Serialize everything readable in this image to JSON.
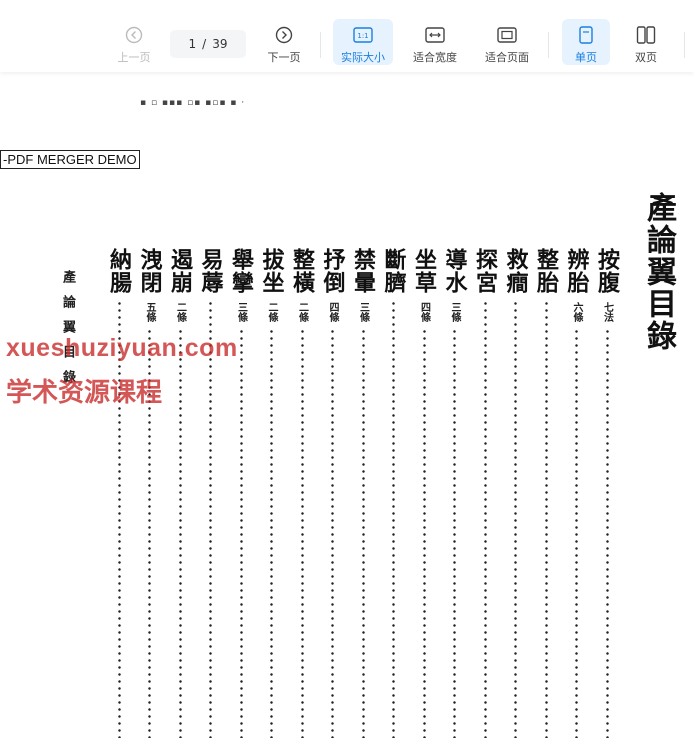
{
  "toolbar": {
    "prev_label": "上一页",
    "page_current": "1",
    "page_sep": "/",
    "page_total": "39",
    "next_label": "下一页",
    "actual_size_label": "实际大小",
    "actual_size_icon_text": "1:1",
    "fit_width_label": "适合宽度",
    "fit_page_label": "适合页面",
    "single_page_label": "单页",
    "double_page_label": "双页",
    "accent_color": "#1a7fe0"
  },
  "document": {
    "stamp": "-PDF MERGER DEMO",
    "title": "產論翼目錄",
    "side_note": "產論翼目錄",
    "columns": [
      {
        "name": "按腹",
        "count": "七法"
      },
      {
        "name": "辨胎",
        "count": "六條"
      },
      {
        "name": "整胎",
        "count": ""
      },
      {
        "name": "救癎",
        "count": ""
      },
      {
        "name": "探宮",
        "count": ""
      },
      {
        "name": "導水",
        "count": "三條"
      },
      {
        "name": "坐草",
        "count": "四條"
      },
      {
        "name": "斷臍",
        "count": ""
      },
      {
        "name": "禁暈",
        "count": "三條"
      },
      {
        "name": "抒倒",
        "count": "四條"
      },
      {
        "name": "整橫",
        "count": "二條"
      },
      {
        "name": "拔坐",
        "count": "二條"
      },
      {
        "name": "舉攣",
        "count": "三條"
      },
      {
        "name": "易蓐",
        "count": ""
      },
      {
        "name": "遏崩",
        "count": "二條"
      },
      {
        "name": "洩閉",
        "count": "五條"
      },
      {
        "name": "納腸",
        "count": ""
      }
    ]
  },
  "watermark": {
    "line1": "xueshuziyuan.com",
    "line2": "学术资源课程"
  }
}
